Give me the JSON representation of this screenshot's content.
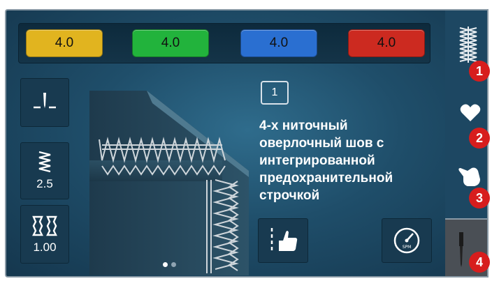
{
  "tensions": [
    {
      "label": "4.0",
      "color": "#e1b41f"
    },
    {
      "label": "4.0",
      "color": "#22b33c"
    },
    {
      "label": "4.0",
      "color": "#2a6fd1"
    },
    {
      "label": "4.0",
      "color": "#cc2a20"
    }
  ],
  "left_panel": {
    "stitch_length": "2.5",
    "differential_feed": "1.00"
  },
  "stitch": {
    "number": "1",
    "title_lines": [
      "4-х ниточный",
      "оверлочный шов с",
      "интегрированной",
      "предохранительной",
      "строчкой"
    ]
  },
  "callouts": [
    "1",
    "2",
    "3",
    "4"
  ],
  "icons": {
    "sidebar": [
      "stitch-pattern-icon",
      "heart-icon",
      "hand-icon",
      "needle-icon"
    ],
    "left": [
      "needle-position-icon",
      "stitch-length-icon",
      "differential-feed-icon"
    ],
    "bottom": [
      "foot-control-icon",
      "speed-gauge-icon"
    ]
  },
  "colors": {
    "accent_red": "#d71d1d",
    "panel": "#183a50"
  }
}
